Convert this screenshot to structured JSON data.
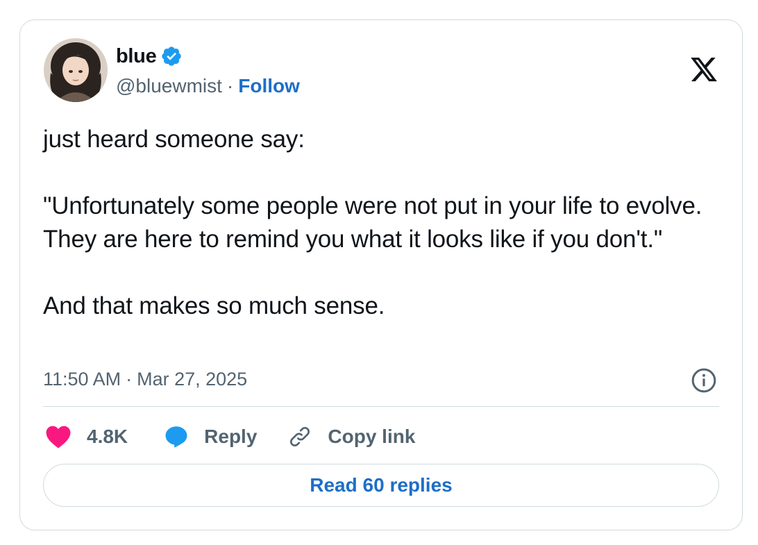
{
  "author": {
    "display_name": "blue",
    "handle": "@bluewmist",
    "separator": "·",
    "follow_label": "Follow"
  },
  "tweet": {
    "paragraphs": [
      "just heard someone say:",
      "\"Unfortunately some people were not put in your life to evolve. They are here to remind you what it looks like if you don't.\"",
      "And that makes so much sense."
    ],
    "time": "11:50 AM",
    "date_separator": "·",
    "date": "Mar 27, 2025"
  },
  "actions": {
    "likes_count": "4.8K",
    "reply_label": "Reply",
    "copy_link_label": "Copy link",
    "read_replies_label": "Read 60 replies"
  },
  "icons": {
    "verified": "verified-badge-icon",
    "logo": "x-logo-icon",
    "info": "info-icon",
    "like": "heart-icon",
    "reply": "speech-bubble-icon",
    "copy_link": "link-icon"
  },
  "colors": {
    "text_primary": "#0f1419",
    "text_secondary": "#536471",
    "link_blue": "#1d6fc8",
    "verified_blue": "#1d9bf0",
    "like_pink": "#f91880",
    "border": "#cfd9de"
  }
}
